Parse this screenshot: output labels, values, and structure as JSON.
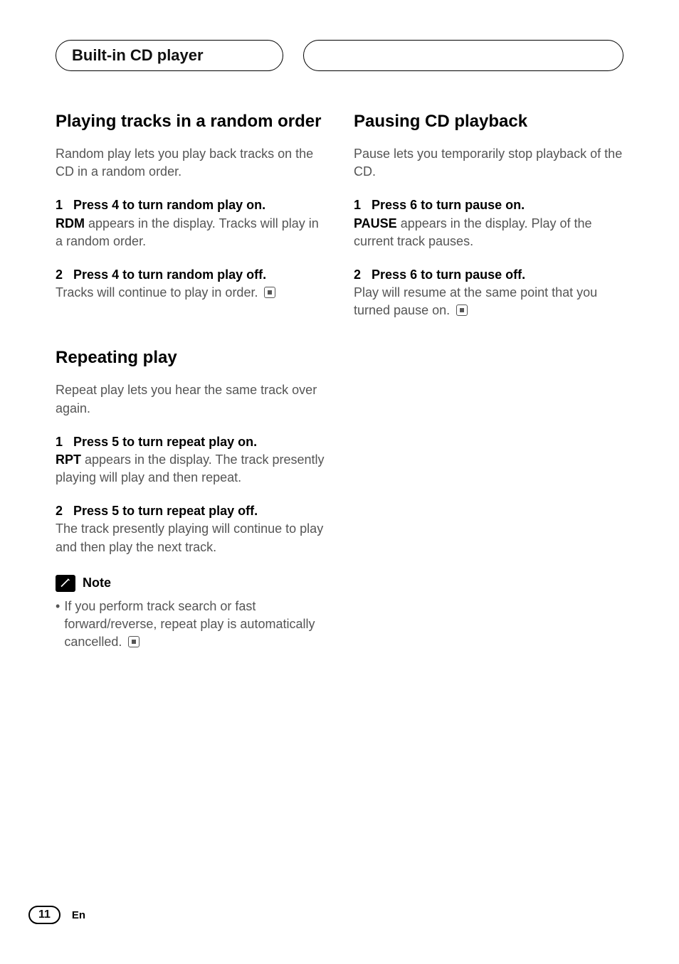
{
  "header": {
    "tab_main": "Built-in CD player"
  },
  "left": {
    "section1": {
      "title": "Playing tracks in a random order",
      "lead": "Random play lets you play back tracks on the CD in a random order.",
      "steps": [
        {
          "num": "1",
          "title": "Press 4 to turn random play on.",
          "desc_prefix_kw": "RDM",
          "desc_rest": " appears in the display. Tracks will play in a random order.",
          "end_icon": false
        },
        {
          "num": "2",
          "title": "Press 4 to turn random play off.",
          "desc_prefix_kw": "",
          "desc_rest": "Tracks will continue to play in order.",
          "end_icon": true
        }
      ]
    },
    "section2": {
      "title": "Repeating play",
      "lead": "Repeat play lets you hear the same track over again.",
      "steps": [
        {
          "num": "1",
          "title": "Press 5 to turn repeat play on.",
          "desc_prefix_kw": "RPT",
          "desc_rest": " appears in the display. The track presently playing will play and then repeat.",
          "end_icon": false
        },
        {
          "num": "2",
          "title": "Press 5 to turn repeat play off.",
          "desc_prefix_kw": "",
          "desc_rest": " The track presently playing will continue to play and then play the next track.",
          "end_icon": false
        }
      ],
      "note": {
        "label": "Note",
        "items": [
          {
            "text": "If you perform track search or fast forward/reverse, repeat play is automatically cancelled.",
            "end_icon": true
          }
        ]
      }
    }
  },
  "right": {
    "section1": {
      "title": "Pausing CD playback",
      "lead": "Pause lets you temporarily stop playback of the CD.",
      "steps": [
        {
          "num": "1",
          "title": "Press 6 to turn pause on.",
          "desc_prefix_kw": "PAUSE",
          "desc_rest": " appears in the display. Play of the current track pauses.",
          "end_icon": false
        },
        {
          "num": "2",
          "title": "Press 6 to turn pause off.",
          "desc_prefix_kw": "",
          "desc_rest": "Play will resume at the same point that you turned pause on.",
          "end_icon": true
        }
      ]
    }
  },
  "footer": {
    "page": "11",
    "lang": "En"
  }
}
